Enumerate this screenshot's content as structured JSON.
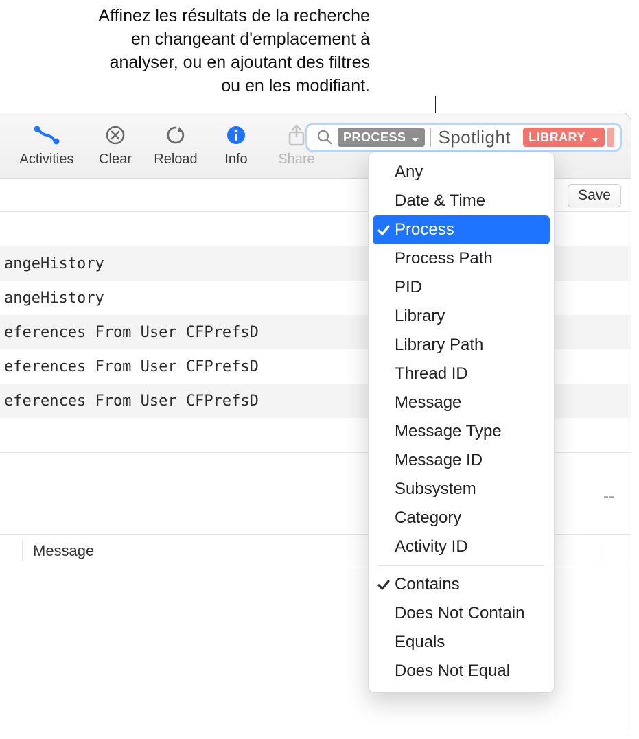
{
  "callout": {
    "line1": "Affinez les résultats de la recherche",
    "line2": "en changeant d'emplacement à",
    "line3": "analyser, ou en ajoutant des filtres",
    "line4": "ou en les modifiant."
  },
  "toolbar": {
    "activities": "Activities",
    "clear": "Clear",
    "reload": "Reload",
    "info": "Info",
    "share": "Share"
  },
  "search": {
    "process_token": "PROCESS",
    "spotlight": "Spotlight",
    "library_token": "LIBRARY"
  },
  "subbar": {
    "save": "Save"
  },
  "rows": [
    "angeHistory",
    "angeHistory",
    "eferences From User CFPrefsD",
    "eferences From User CFPrefsD",
    "eferences From User CFPrefsD"
  ],
  "details": {
    "dashes": "--"
  },
  "message_header": "Message",
  "menu": {
    "group1": [
      "Any",
      "Date & Time",
      "Process",
      "Process Path",
      "PID",
      "Library",
      "Library Path",
      "Thread ID",
      "Message",
      "Message Type",
      "Message ID",
      "Subsystem",
      "Category",
      "Activity ID"
    ],
    "selected1": "Process",
    "group2": [
      "Contains",
      "Does Not Contain",
      "Equals",
      "Does Not Equal"
    ],
    "selected2": "Contains"
  }
}
